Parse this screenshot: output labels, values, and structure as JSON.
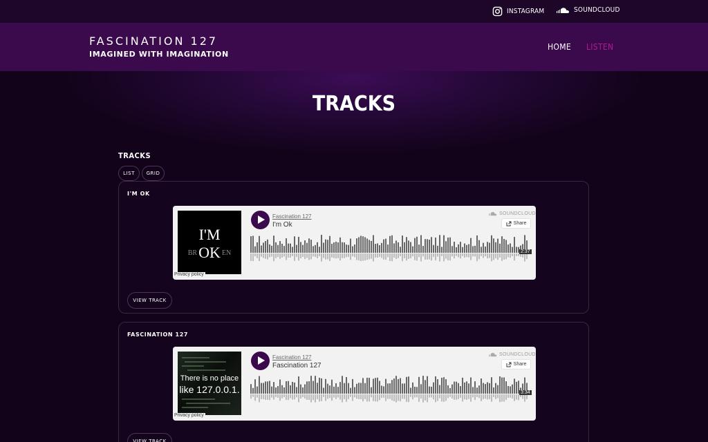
{
  "topbar": {
    "instagram_label": "INSTAGRAM",
    "soundcloud_label": "SOUNDCLOUD"
  },
  "brand": {
    "title": "FASCINATION 127",
    "tagline": "IMAGINED WITH IMAGINATION"
  },
  "nav": {
    "home": "HOME",
    "listen": "LISTEN"
  },
  "page_title": "TRACKS",
  "section": {
    "label": "TRACKS",
    "view_list": "LIST",
    "view_grid": "GRID"
  },
  "tracks": [
    {
      "title": "I'M OK",
      "artist": "Fascination 127",
      "name": "I'm Ok",
      "duration": "2:37",
      "artwork": {
        "line1": "I'M",
        "left": "BR",
        "center": "OK",
        "right": "EN"
      },
      "view_label": "VIEW TRACK"
    },
    {
      "title": "FASCINATION 127",
      "artist": "Fascination 127",
      "name": "Fascination 127",
      "duration": "3:34",
      "artwork": {
        "line1": "There is no place",
        "line2": "like 127.0.0.1."
      },
      "view_label": "VIEW TRACK"
    }
  ],
  "player": {
    "brand": "SOUNDCLOUD",
    "share_label": "Share",
    "privacy_label": "Privacy policy"
  },
  "colors": {
    "accent": "#b21a8f",
    "navbar": "#3b0a4d",
    "topbar": "#1e0628",
    "background": "#12031a"
  }
}
